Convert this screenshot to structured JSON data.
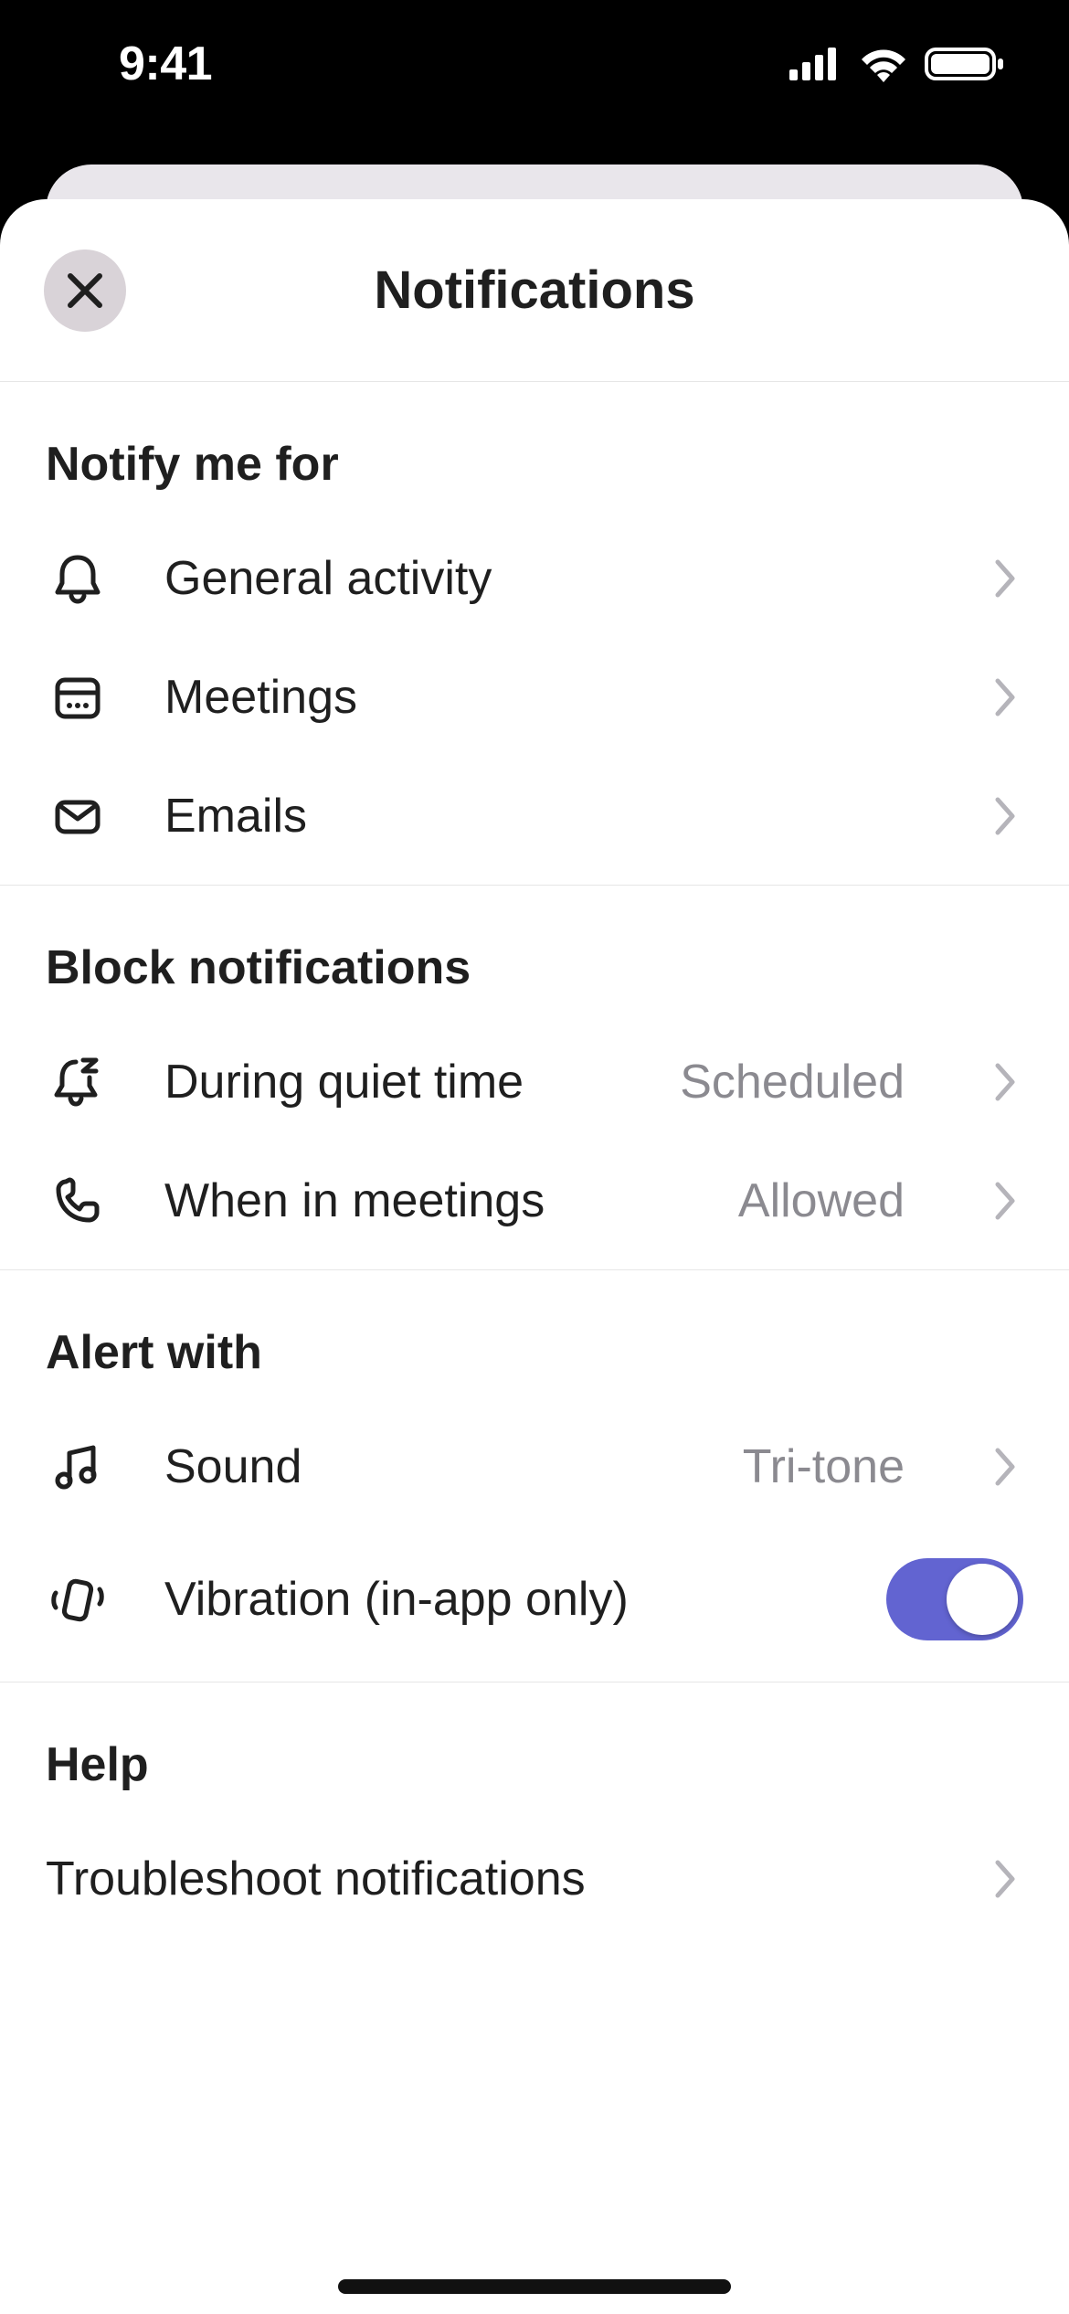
{
  "status": {
    "time": "9:41"
  },
  "header": {
    "title": "Notifications"
  },
  "sections": {
    "notify": {
      "title": "Notify me for",
      "items": [
        {
          "label": "General activity"
        },
        {
          "label": "Meetings"
        },
        {
          "label": "Emails"
        }
      ]
    },
    "block": {
      "title": "Block notifications",
      "items": [
        {
          "label": "During quiet time",
          "value": "Scheduled"
        },
        {
          "label": "When in meetings",
          "value": "Allowed"
        }
      ]
    },
    "alert": {
      "title": "Alert with",
      "sound": {
        "label": "Sound",
        "value": "Tri-tone"
      },
      "vibration": {
        "label": "Vibration (in-app only)",
        "on": true
      }
    },
    "help": {
      "title": "Help",
      "troubleshoot": {
        "label": "Troubleshoot notifications"
      }
    }
  }
}
